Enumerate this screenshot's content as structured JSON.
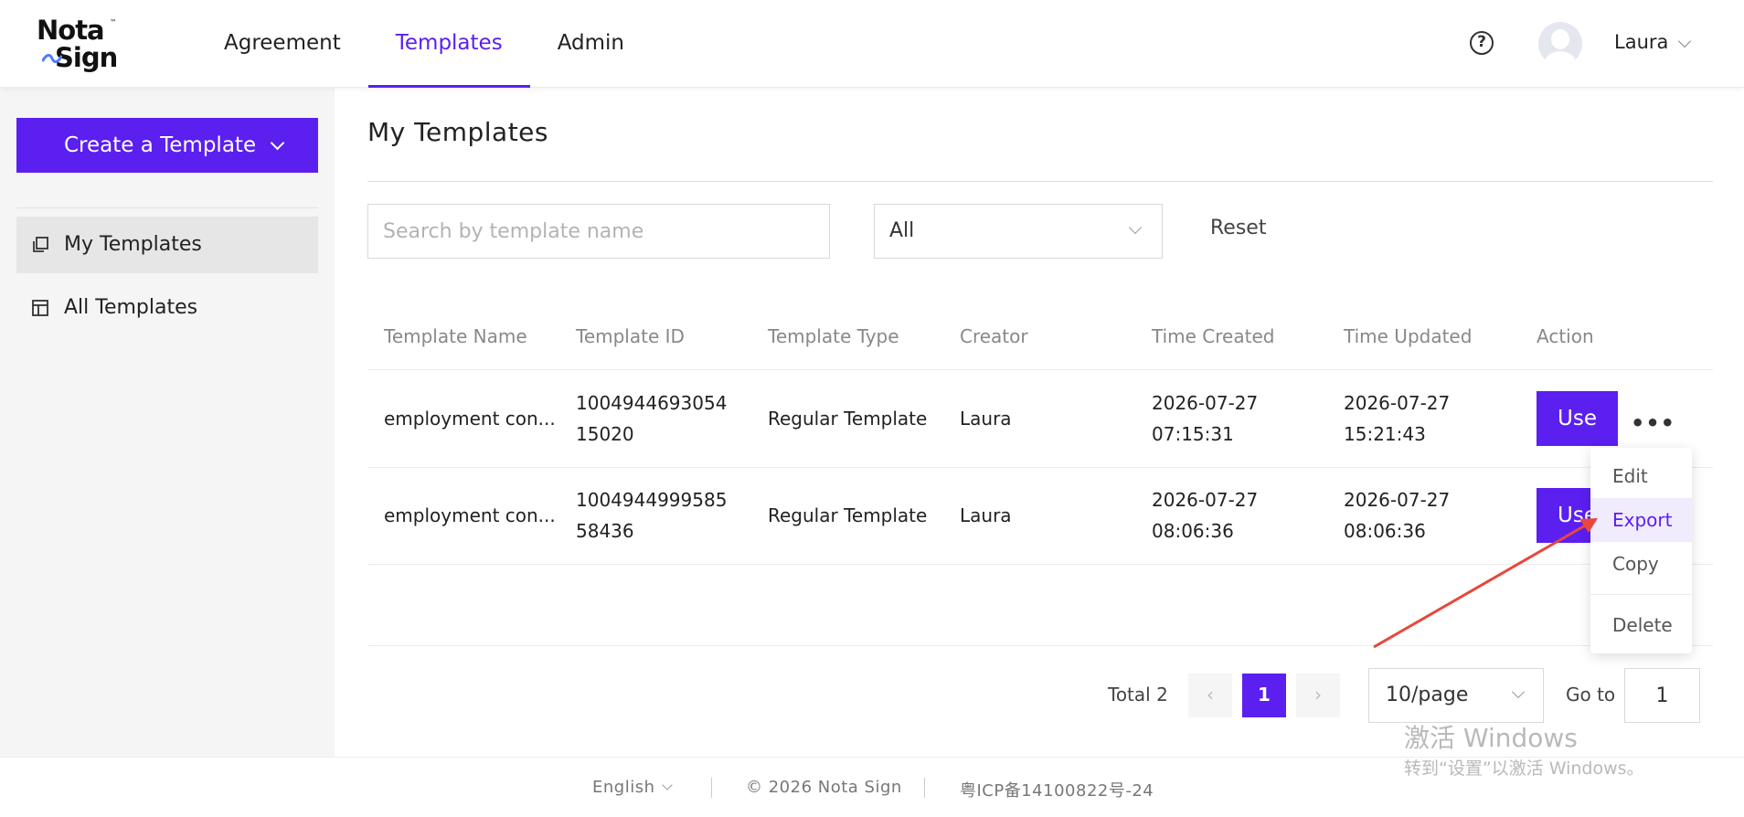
{
  "header": {
    "logo_line1": "Nota",
    "logo_tm": "™",
    "logo_line2": "Sign",
    "nav": [
      {
        "label": "Agreement"
      },
      {
        "label": "Templates"
      },
      {
        "label": "Admin"
      }
    ],
    "help_glyph": "?",
    "user_name": "Laura"
  },
  "sidebar": {
    "create_label": "Create a Template",
    "items": [
      {
        "label": "My Templates",
        "icon": "templates-stack-icon"
      },
      {
        "label": "All Templates",
        "icon": "layout-icon"
      }
    ]
  },
  "main": {
    "title": "My Templates",
    "search_placeholder": "Search by template name",
    "type_filter": "All",
    "reset_label": "Reset",
    "columns": [
      "Template Name",
      "Template ID",
      "Template Type",
      "Creator",
      "Time Created",
      "Time Updated",
      "Action"
    ],
    "rows": [
      {
        "name": "employment con...",
        "id_line1": "1004944693054",
        "id_line2": "15020",
        "type": "Regular Template",
        "creator": "Laura",
        "created_date": "2026-07-27",
        "created_time": "07:15:31",
        "updated_date": "2026-07-27",
        "updated_time": "15:21:43",
        "action": "Use"
      },
      {
        "name": "employment con...",
        "id_line1": "1004944999585",
        "id_line2": "58436",
        "type": "Regular Template",
        "creator": "Laura",
        "created_date": "2026-07-27",
        "created_time": "08:06:36",
        "updated_date": "2026-07-27",
        "updated_time": "08:06:36",
        "action": "Use"
      }
    ],
    "more_glyph": "•••",
    "menu": {
      "items": [
        "Edit",
        "Export",
        "Copy",
        "Delete"
      ],
      "highlighted": "Export"
    }
  },
  "pagination": {
    "total_text": "Total 2",
    "prev_glyph": "‹",
    "next_glyph": "›",
    "current_page": "1",
    "page_size": "10/page",
    "goto_label": "Go to",
    "goto_value": "1"
  },
  "watermark": {
    "line1": "激活 Windows",
    "line2": "转到“设置”以激活 Windows。"
  },
  "footer": {
    "language": "English",
    "copyright": "© 2026 Nota Sign",
    "icp": "粤ICP备14100822号-24"
  },
  "colors": {
    "accent": "#5b1ff0",
    "annotation_arrow": "#e8473a",
    "menu_highlight_bg": "#f1ebfe"
  }
}
